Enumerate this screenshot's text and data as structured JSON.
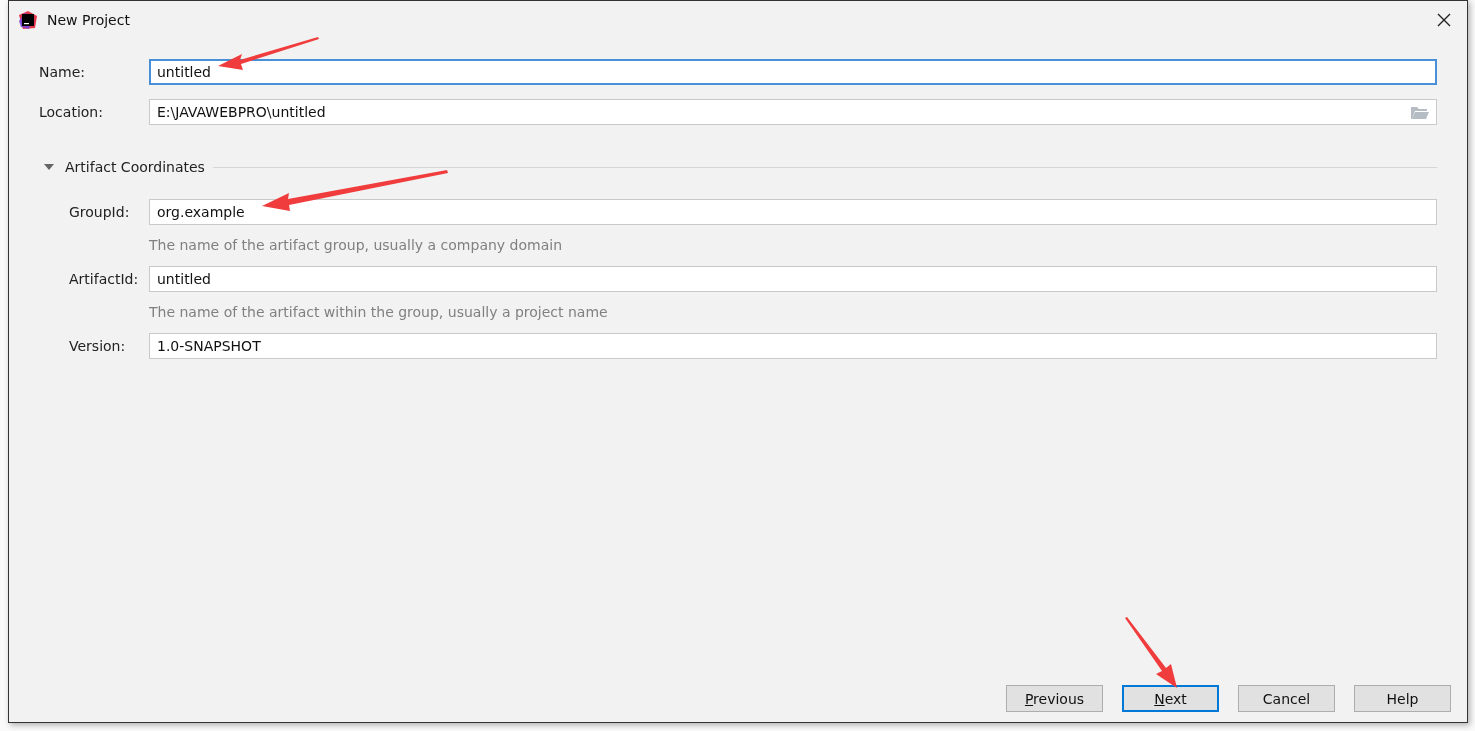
{
  "window": {
    "title": "New Project"
  },
  "fields": [
    {
      "label": "Name:",
      "value": "untitled",
      "focused": true,
      "kind": "text"
    },
    {
      "label": "Location:",
      "value": "E:\\JAVAWEBPRO\\untitled",
      "focused": false,
      "kind": "path"
    }
  ],
  "section": {
    "title": "Artifact Coordinates",
    "expanded": true,
    "fields": [
      {
        "label": "GroupId:",
        "value": "org.example",
        "hint": "The name of the artifact group, usually a company domain"
      },
      {
        "label": "ArtifactId:",
        "value": "untitled",
        "hint": "The name of the artifact within the group, usually a project name"
      },
      {
        "label": "Version:",
        "value": "1.0-SNAPSHOT"
      }
    ]
  },
  "buttons": [
    {
      "mnemonic": "P",
      "rest": "revious",
      "default": false
    },
    {
      "mnemonic": "N",
      "rest": "ext",
      "default": true
    },
    {
      "rest": "Cancel",
      "default": false
    },
    {
      "rest": "Help",
      "default": false
    }
  ]
}
